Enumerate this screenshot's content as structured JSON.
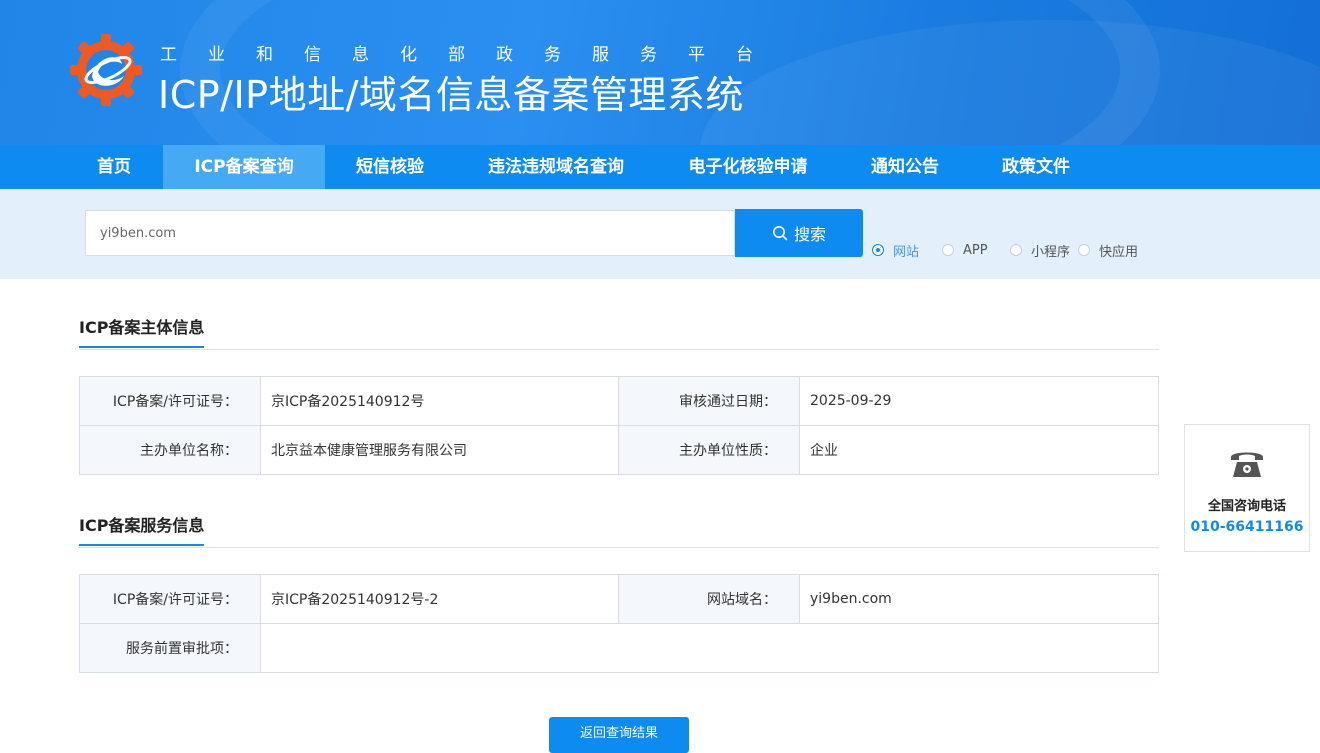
{
  "header": {
    "subtitle": "工业和信息化部政务服务平台",
    "title": "ICP/IP地址/域名信息备案管理系统"
  },
  "nav": {
    "items": [
      {
        "label": "首页"
      },
      {
        "label": "ICP备案查询",
        "active": true
      },
      {
        "label": "短信核验"
      },
      {
        "label": "违法违规域名查询"
      },
      {
        "label": "电子化核验申请"
      },
      {
        "label": "通知公告"
      },
      {
        "label": "政策文件"
      }
    ]
  },
  "search": {
    "value": "yi9ben.com",
    "button_label": "搜索",
    "options": [
      {
        "label": "网站",
        "checked": true
      },
      {
        "label": "APP",
        "checked": false
      },
      {
        "label": "小程序",
        "checked": false
      },
      {
        "label": "快应用",
        "checked": false
      }
    ]
  },
  "subject_section": {
    "title": "ICP备案主体信息",
    "rows": [
      {
        "label1": "ICP备案/许可证号：",
        "value1": "京ICP备2025140912号",
        "label2": "审核通过日期：",
        "value2": "2025-09-29"
      },
      {
        "label1": "主办单位名称：",
        "value1": "北京益本健康管理服务有限公司",
        "label2": "主办单位性质：",
        "value2": "企业"
      }
    ]
  },
  "service_section": {
    "title": "ICP备案服务信息",
    "row1": {
      "label1": "ICP备案/许可证号：",
      "value1": "京ICP备2025140912号-2",
      "label2": "网站域名：",
      "value2": "yi9ben.com"
    },
    "row2": {
      "label1": "服务前置审批项：",
      "value1": ""
    }
  },
  "contact": {
    "title": "全国咨询电话",
    "phone": "010-66411166",
    "icon": "telephone-icon"
  },
  "back_button_label": "返回查询结果",
  "colors": {
    "primary": "#0e8bf0",
    "nav_active": "#46a9f4",
    "search_band": "#e3f0fc",
    "logo_orange": "#f05a22"
  }
}
